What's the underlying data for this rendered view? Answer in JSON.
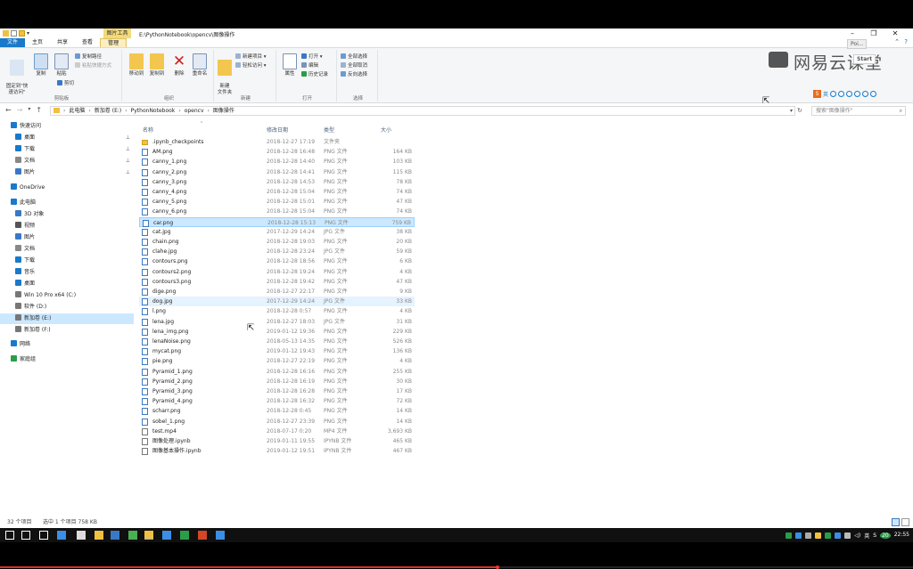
{
  "window": {
    "title_path": "E:\\PythonNotebook\\opencv\\图像操作",
    "context_tab": "图片工具",
    "controls": [
      "–",
      "❐",
      "✕"
    ]
  },
  "ribbon_tabs": [
    "文件",
    "主页",
    "共享",
    "查看",
    "管理"
  ],
  "ribbon": {
    "clipboard": {
      "group_name": "剪贴板",
      "pin_quick_access": "固定到\"快\n速访问\"",
      "copy": "复制",
      "paste": "粘贴",
      "copy_path": "复制路径",
      "paste_shortcut": "粘贴快捷方式",
      "cut": "剪切"
    },
    "organize": {
      "group_name": "组织",
      "move_to": "移动到",
      "copy_to": "复制到",
      "delete": "删除",
      "rename": "重命名"
    },
    "new": {
      "group_name": "新建",
      "new_folder": "新建\n文件夹",
      "new_item": "新建项目 ▾",
      "easy_access": "轻松访问 ▾"
    },
    "open": {
      "group_name": "打开",
      "properties": "属性",
      "open": "打开 ▾",
      "edit": "编辑",
      "history": "历史记录"
    },
    "select": {
      "group_name": "选择",
      "select_all": "全部选择",
      "select_none": "全部取消",
      "invert": "反向选择"
    }
  },
  "watermark": {
    "brand": "网易云课堂",
    "overlay_label": "Poi...",
    "start_label": "Start",
    "ime_label": "英"
  },
  "address": {
    "crumbs": [
      "此电脑",
      "新加卷 (E:)",
      "PythonNotebook",
      "opencv",
      "图像操作"
    ],
    "search_placeholder": "搜索\"图像操作\""
  },
  "nav": [
    {
      "label": "快速访问",
      "icon": "star-icon",
      "color": "#1979ca",
      "indent": 0,
      "pinned": false
    },
    {
      "label": "桌面",
      "icon": "desktop-icon",
      "color": "#1979ca",
      "indent": 1,
      "pinned": true
    },
    {
      "label": "下载",
      "icon": "download-icon",
      "color": "#1979ca",
      "indent": 1,
      "pinned": true
    },
    {
      "label": "文档",
      "icon": "document-icon",
      "color": "#888888",
      "indent": 1,
      "pinned": true
    },
    {
      "label": "图片",
      "icon": "picture-icon",
      "color": "#3a78c5",
      "indent": 1,
      "pinned": true
    },
    {
      "label": "OneDrive",
      "icon": "cloud-icon",
      "color": "#1979ca",
      "indent": 0,
      "pinned": false
    },
    {
      "label": "此电脑",
      "icon": "pc-icon",
      "color": "#1979ca",
      "indent": 0,
      "pinned": false
    },
    {
      "label": "3D 对象",
      "icon": "cube-icon",
      "color": "#3a78c5",
      "indent": 1,
      "pinned": false
    },
    {
      "label": "视频",
      "icon": "video-icon",
      "color": "#555555",
      "indent": 1,
      "pinned": false
    },
    {
      "label": "图片",
      "icon": "picture-icon",
      "color": "#3a78c5",
      "indent": 1,
      "pinned": false
    },
    {
      "label": "文档",
      "icon": "document-icon",
      "color": "#888888",
      "indent": 1,
      "pinned": false
    },
    {
      "label": "下载",
      "icon": "download-icon",
      "color": "#1979ca",
      "indent": 1,
      "pinned": false
    },
    {
      "label": "音乐",
      "icon": "music-icon",
      "color": "#1979ca",
      "indent": 1,
      "pinned": false
    },
    {
      "label": "桌面",
      "icon": "desktop-icon",
      "color": "#1979ca",
      "indent": 1,
      "pinned": false
    },
    {
      "label": "Win 10 Pro x64 (C:)",
      "icon": "drive-icon",
      "color": "#777777",
      "indent": 1,
      "pinned": false
    },
    {
      "label": "软件 (D:)",
      "icon": "drive-icon",
      "color": "#777777",
      "indent": 1,
      "pinned": false
    },
    {
      "label": "新加卷 (E:)",
      "icon": "drive-icon",
      "color": "#777777",
      "indent": 1,
      "pinned": false,
      "selected": true
    },
    {
      "label": "新加卷 (F:)",
      "icon": "drive-icon",
      "color": "#777777",
      "indent": 1,
      "pinned": false
    },
    {
      "label": "网络",
      "icon": "network-icon",
      "color": "#1979ca",
      "indent": 0,
      "pinned": false
    },
    {
      "label": "家庭组",
      "icon": "homegroup-icon",
      "color": "#2a9d4a",
      "indent": 0,
      "pinned": false
    }
  ],
  "columns": {
    "name": "名称",
    "date": "修改日期",
    "type": "类型",
    "size": "大小"
  },
  "files": [
    {
      "name": ".ipynb_checkpoints",
      "date": "2018-12-27 17:19",
      "type": "文件夹",
      "size": "",
      "kind": "folder"
    },
    {
      "name": "AM.png",
      "date": "2018-12-28 16:48",
      "type": "PNG 文件",
      "size": "164 KB",
      "kind": "image"
    },
    {
      "name": "canny_1.png",
      "date": "2018-12-28 14:40",
      "type": "PNG 文件",
      "size": "103 KB",
      "kind": "image"
    },
    {
      "name": "canny_2.png",
      "date": "2018-12-28 14:41",
      "type": "PNG 文件",
      "size": "115 KB",
      "kind": "image"
    },
    {
      "name": "canny_3.png",
      "date": "2018-12-28 14:53",
      "type": "PNG 文件",
      "size": "78 KB",
      "kind": "image"
    },
    {
      "name": "canny_4.png",
      "date": "2018-12-28 15:04",
      "type": "PNG 文件",
      "size": "74 KB",
      "kind": "image"
    },
    {
      "name": "canny_5.png",
      "date": "2018-12-28 15:01",
      "type": "PNG 文件",
      "size": "47 KB",
      "kind": "image"
    },
    {
      "name": "canny_6.png",
      "date": "2018-12-28 15:04",
      "type": "PNG 文件",
      "size": "74 KB",
      "kind": "image"
    },
    {
      "name": "car.png",
      "date": "2018-12-28 15:13",
      "type": "PNG 文件",
      "size": "759 KB",
      "kind": "image",
      "selected": true
    },
    {
      "name": "cat.jpg",
      "date": "2017-12-29 14:24",
      "type": "JPG 文件",
      "size": "38 KB",
      "kind": "image"
    },
    {
      "name": "chain.png",
      "date": "2018-12-28 19:03",
      "type": "PNG 文件",
      "size": "20 KB",
      "kind": "image"
    },
    {
      "name": "clahe.jpg",
      "date": "2018-12-28 23:24",
      "type": "JPG 文件",
      "size": "59 KB",
      "kind": "image"
    },
    {
      "name": "contours.png",
      "date": "2018-12-28 18:56",
      "type": "PNG 文件",
      "size": "6 KB",
      "kind": "image"
    },
    {
      "name": "contours2.png",
      "date": "2018-12-28 19:24",
      "type": "PNG 文件",
      "size": "4 KB",
      "kind": "image"
    },
    {
      "name": "contours3.png",
      "date": "2018-12-28 19:42",
      "type": "PNG 文件",
      "size": "47 KB",
      "kind": "image"
    },
    {
      "name": "dige.png",
      "date": "2018-12-27 22:17",
      "type": "PNG 文件",
      "size": "9 KB",
      "kind": "image"
    },
    {
      "name": "dog.jpg",
      "date": "2017-12-29 14:24",
      "type": "JPG 文件",
      "size": "33 KB",
      "kind": "image",
      "hover": true
    },
    {
      "name": "l.png",
      "date": "2018-12-28 0:57",
      "type": "PNG 文件",
      "size": "4 KB",
      "kind": "image"
    },
    {
      "name": "lena.jpg",
      "date": "2018-12-27 18:03",
      "type": "JPG 文件",
      "size": "31 KB",
      "kind": "image"
    },
    {
      "name": "lena_img.png",
      "date": "2019-01-12 19:36",
      "type": "PNG 文件",
      "size": "229 KB",
      "kind": "image"
    },
    {
      "name": "lenaNoise.png",
      "date": "2018-05-13 14:35",
      "type": "PNG 文件",
      "size": "526 KB",
      "kind": "image"
    },
    {
      "name": "mycat.png",
      "date": "2019-01-12 19:43",
      "type": "PNG 文件",
      "size": "136 KB",
      "kind": "image"
    },
    {
      "name": "pie.png",
      "date": "2018-12-27 22:19",
      "type": "PNG 文件",
      "size": "4 KB",
      "kind": "image"
    },
    {
      "name": "Pyramid_1.png",
      "date": "2018-12-28 16:16",
      "type": "PNG 文件",
      "size": "255 KB",
      "kind": "image"
    },
    {
      "name": "Pyramid_2.png",
      "date": "2018-12-28 16:19",
      "type": "PNG 文件",
      "size": "30 KB",
      "kind": "image"
    },
    {
      "name": "Pyramid_3.png",
      "date": "2018-12-28 16:28",
      "type": "PNG 文件",
      "size": "17 KB",
      "kind": "image"
    },
    {
      "name": "Pyramid_4.png",
      "date": "2018-12-28 16:32",
      "type": "PNG 文件",
      "size": "72 KB",
      "kind": "image"
    },
    {
      "name": "scharr.png",
      "date": "2018-12-28 0:45",
      "type": "PNG 文件",
      "size": "14 KB",
      "kind": "image"
    },
    {
      "name": "sobel_1.png",
      "date": "2018-12-27 23:39",
      "type": "PNG 文件",
      "size": "14 KB",
      "kind": "image"
    },
    {
      "name": "test.mp4",
      "date": "2018-07-17 0:20",
      "type": "MP4 文件",
      "size": "3,693 KB",
      "kind": "other"
    },
    {
      "name": "图像处理.ipynb",
      "date": "2019-01-11 19:55",
      "type": "IPYNB 文件",
      "size": "465 KB",
      "kind": "other"
    },
    {
      "name": "图像基本操作.ipynb",
      "date": "2019-01-12 19:51",
      "type": "IPYNB 文件",
      "size": "467 KB",
      "kind": "other"
    }
  ],
  "status": {
    "count": "32 个项目",
    "selection": "选中 1 个项目  758 KB"
  },
  "taskbar": {
    "apps": [
      {
        "name": "start-icon",
        "color": "#ffffff"
      },
      {
        "name": "cortana-icon",
        "color": "#ffffff"
      },
      {
        "name": "task-view-icon",
        "color": "#ffffff"
      },
      {
        "name": "edge-icon",
        "color": "#3a8ee6"
      },
      {
        "name": "store-icon",
        "color": "#dddddd"
      },
      {
        "name": "lock-icon",
        "color": "#f0c040"
      },
      {
        "name": "mail-icon",
        "color": "#3a78c5"
      },
      {
        "name": "chrome-icon",
        "color": "#4caf50"
      },
      {
        "name": "explorer-icon",
        "color": "#f0c040",
        "active": true
      },
      {
        "name": "monitor-icon",
        "color": "#3a8ee6"
      },
      {
        "name": "excel-icon",
        "color": "#2a9d4a"
      },
      {
        "name": "powerpoint-icon",
        "color": "#d24726"
      },
      {
        "name": "paint-icon",
        "color": "#3a8ee6"
      }
    ],
    "tray_lang": "英",
    "tray_badge": "20",
    "time": "22:55"
  },
  "video": {
    "progress": 0.545
  }
}
